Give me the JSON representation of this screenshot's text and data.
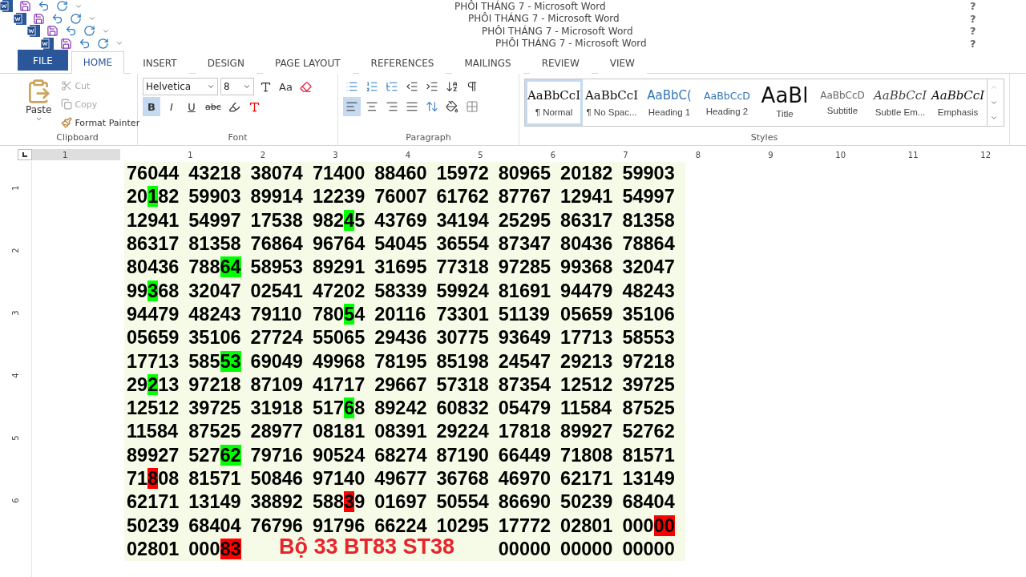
{
  "title_bars": [
    {
      "title": "PHÔI THÁNG 7 - Microsoft Word",
      "help": "?"
    },
    {
      "title": "PHÔI THÁNG 7 - Microsoft Word",
      "help": "?"
    },
    {
      "title": "PHÔI THÁNG 7 - Microsoft Word",
      "help": "?"
    },
    {
      "title": "PHÔI THÁNG 7 - Microsoft Word",
      "help": "?"
    }
  ],
  "tabs": [
    {
      "label": "FILE",
      "kind": "file",
      "selected": false
    },
    {
      "label": "HOME",
      "kind": "tab",
      "selected": true
    },
    {
      "label": "INSERT",
      "kind": "tab",
      "selected": false
    },
    {
      "label": "DESIGN",
      "kind": "tab",
      "selected": false
    },
    {
      "label": "PAGE LAYOUT",
      "kind": "tab",
      "selected": false
    },
    {
      "label": "REFERENCES",
      "kind": "tab",
      "selected": false
    },
    {
      "label": "MAILINGS",
      "kind": "tab",
      "selected": false
    },
    {
      "label": "REVIEW",
      "kind": "tab",
      "selected": false
    },
    {
      "label": "VIEW",
      "kind": "tab",
      "selected": false
    }
  ],
  "clipboard": {
    "label": "Clipboard",
    "paste": "Paste",
    "cut": "Cut",
    "copy": "Copy",
    "format_painter": "Format Painter"
  },
  "font": {
    "label": "Font",
    "name": "Helvetica",
    "size": "8",
    "change_case": "Aa",
    "bold": {
      "text": "B",
      "selected": true
    },
    "italic": {
      "text": "I",
      "selected": false
    },
    "underline": {
      "text": "U",
      "selected": false
    },
    "strikethrough": "abc"
  },
  "paragraph": {
    "label": "Paragraph",
    "alignments": [
      {
        "kind": "left",
        "selected": true
      },
      {
        "kind": "center",
        "selected": false
      },
      {
        "kind": "right",
        "selected": false
      },
      {
        "kind": "justify",
        "selected": false
      }
    ]
  },
  "styles": {
    "label": "Styles",
    "items": [
      {
        "preview": "AaBbCcI",
        "name": "¶ Normal",
        "kind": "normal",
        "selected": true
      },
      {
        "preview": "AaBbCcI",
        "name": "¶ No Spac...",
        "kind": "normal",
        "selected": false
      },
      {
        "preview": "AaBbC(",
        "name": "Heading 1",
        "kind": "heading1",
        "selected": false
      },
      {
        "preview": "AaBbCcD",
        "name": "Heading 2",
        "kind": "heading2",
        "selected": false
      },
      {
        "preview": "AaBl",
        "name": "Title",
        "kind": "title",
        "selected": false
      },
      {
        "preview": "AaBbCcD",
        "name": "Subtitle",
        "kind": "subtitle",
        "selected": false
      },
      {
        "preview": "AaBbCcI",
        "name": "Subtle Em...",
        "kind": "subtle",
        "selected": false
      },
      {
        "preview": "AaBbCcI",
        "name": "Emphasis",
        "kind": "emphasis",
        "selected": false
      }
    ]
  },
  "ruler": {
    "left_number": "1",
    "numbers": [
      "1",
      "2",
      "3",
      "4",
      "5",
      "6",
      "7",
      "8",
      "9",
      "10",
      "11",
      "12"
    ],
    "vertical_numbers": [
      "1",
      "2",
      "3",
      "4",
      "5",
      "6"
    ]
  },
  "document": {
    "rows": [
      [
        [
          "76044"
        ],
        [
          "43218"
        ],
        [
          "38074"
        ],
        [
          "71400"
        ],
        [
          "88460"
        ],
        [
          "15972"
        ],
        [
          "80965"
        ],
        [
          "20182"
        ],
        [
          "59903"
        ]
      ],
      [
        [
          "20",
          {
            "text": "1",
            "color": "#00ff00"
          },
          "82"
        ],
        [
          "59903"
        ],
        [
          "89914"
        ],
        [
          "12239"
        ],
        [
          "76007"
        ],
        [
          "61762"
        ],
        [
          "87767"
        ],
        [
          "12941"
        ],
        [
          "54997"
        ]
      ],
      [
        [
          "12941"
        ],
        [
          "54997"
        ],
        [
          "17538"
        ],
        [
          "982",
          {
            "text": "4",
            "color": "#00ff00"
          },
          "5"
        ],
        [
          "43769"
        ],
        [
          "34194"
        ],
        [
          "25295"
        ],
        [
          "86317"
        ],
        [
          "81358"
        ]
      ],
      [
        [
          "86317"
        ],
        [
          "81358"
        ],
        [
          "76864"
        ],
        [
          "96764"
        ],
        [
          "54045"
        ],
        [
          "36554"
        ],
        [
          "87347"
        ],
        [
          "80436"
        ],
        [
          "78864"
        ]
      ],
      [
        [
          "80436"
        ],
        [
          "788",
          {
            "text": "64",
            "color": "#00ff00"
          }
        ],
        [
          "58953"
        ],
        [
          "89291"
        ],
        [
          "31695"
        ],
        [
          "77318"
        ],
        [
          "97285"
        ],
        [
          "99368"
        ],
        [
          "32047"
        ]
      ],
      [
        [
          "99",
          {
            "text": "3",
            "color": "#00ff00"
          },
          "68"
        ],
        [
          "32047"
        ],
        [
          "02541"
        ],
        [
          "47202"
        ],
        [
          "58339"
        ],
        [
          "59924"
        ],
        [
          "81691"
        ],
        [
          "94479"
        ],
        [
          "48243"
        ]
      ],
      [
        [
          "94479"
        ],
        [
          "48243"
        ],
        [
          "79110"
        ],
        [
          "780",
          {
            "text": "5",
            "color": "#00ff00"
          },
          "4"
        ],
        [
          "20116"
        ],
        [
          "73301"
        ],
        [
          "51139"
        ],
        [
          "05659"
        ],
        [
          "35106"
        ]
      ],
      [
        [
          "05659"
        ],
        [
          "35106"
        ],
        [
          "27724"
        ],
        [
          "55065"
        ],
        [
          "29436"
        ],
        [
          "30775"
        ],
        [
          "93649"
        ],
        [
          "17713"
        ],
        [
          "58553"
        ]
      ],
      [
        [
          "17713"
        ],
        [
          "585",
          {
            "text": "53",
            "color": "#00ff00"
          }
        ],
        [
          "69049"
        ],
        [
          "49968"
        ],
        [
          "78195"
        ],
        [
          "85198"
        ],
        [
          "24547"
        ],
        [
          "29213"
        ],
        [
          "97218"
        ]
      ],
      [
        [
          "29",
          {
            "text": "2",
            "color": "#00ff00"
          },
          "13"
        ],
        [
          "97218"
        ],
        [
          "87109"
        ],
        [
          "41717"
        ],
        [
          "29667"
        ],
        [
          "57318"
        ],
        [
          "87354"
        ],
        [
          "12512"
        ],
        [
          "39725"
        ]
      ],
      [
        [
          "12512"
        ],
        [
          "39725"
        ],
        [
          "31918"
        ],
        [
          "517",
          {
            "text": "6",
            "color": "#00ff00"
          },
          "8"
        ],
        [
          "89242"
        ],
        [
          "60832"
        ],
        [
          "05479"
        ],
        [
          "11584"
        ],
        [
          "87525"
        ]
      ],
      [
        [
          "11584"
        ],
        [
          "87525"
        ],
        [
          "28977"
        ],
        [
          "08181"
        ],
        [
          "08391"
        ],
        [
          "29224"
        ],
        [
          "17818"
        ],
        [
          "89927"
        ],
        [
          "52762"
        ]
      ],
      [
        [
          "89927"
        ],
        [
          "527",
          {
            "text": "62",
            "color": "#00ff00"
          }
        ],
        [
          "79716"
        ],
        [
          "90524"
        ],
        [
          "68274"
        ],
        [
          "87190"
        ],
        [
          "66449"
        ],
        [
          "71808"
        ],
        [
          "81571"
        ]
      ],
      [
        [
          "71",
          {
            "text": "8",
            "color": "#ff0000"
          },
          "08"
        ],
        [
          "81571"
        ],
        [
          "50846"
        ],
        [
          "97140"
        ],
        [
          "49677"
        ],
        [
          "36768"
        ],
        [
          "46970"
        ],
        [
          "62171"
        ],
        [
          "13149"
        ]
      ],
      [
        [
          "62171"
        ],
        [
          "13149"
        ],
        [
          "38892"
        ],
        [
          "588",
          {
            "text": "3",
            "color": "#ff0000"
          },
          "9"
        ],
        [
          "01697"
        ],
        [
          "50554"
        ],
        [
          "86690"
        ],
        [
          "50239"
        ],
        [
          "68404"
        ]
      ],
      [
        [
          "50239"
        ],
        [
          "68404"
        ],
        [
          "76796"
        ],
        [
          "91796"
        ],
        [
          "66224"
        ],
        [
          "10295"
        ],
        [
          "17772"
        ],
        [
          "02801"
        ],
        [
          "000",
          {
            "text": "00",
            "color": "#ff0000"
          }
        ]
      ],
      [
        [
          "02801"
        ],
        [
          "000",
          {
            "text": "83",
            "color": "#ff0000"
          }
        ],
        null,
        null,
        null,
        null,
        [
          "00000"
        ],
        [
          "00000"
        ],
        [
          "00000"
        ]
      ]
    ],
    "overlay_text": "Bộ 33 BT83 ST38"
  }
}
